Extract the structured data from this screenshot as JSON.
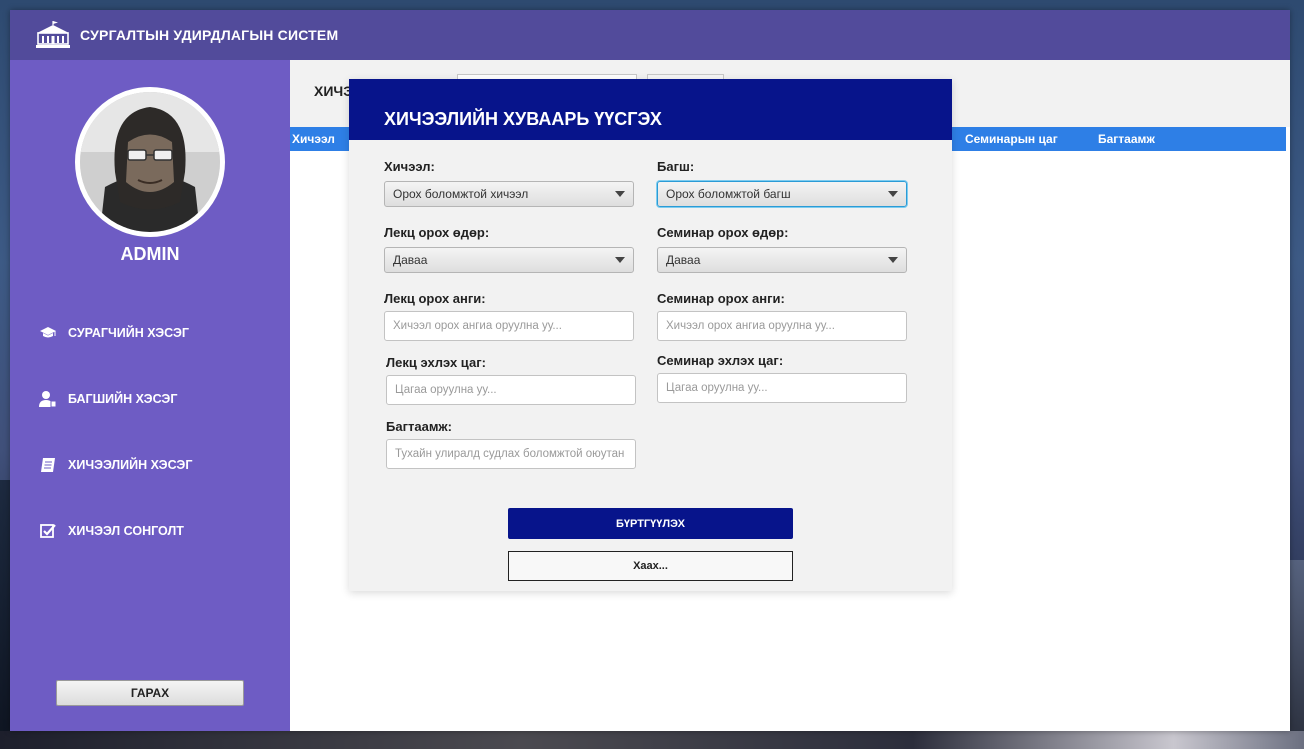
{
  "app": {
    "title": "СУРГАЛТЫН УДИРДЛАГЫН СИСТЕМ"
  },
  "sidebar": {
    "user_name": "ADMIN",
    "items": [
      {
        "label": "СУРАГЧИЙН ХЭСЭГ",
        "icon": "graduation-cap-icon"
      },
      {
        "label": "БАГШИЙН ХЭСЭГ",
        "icon": "teacher-icon"
      },
      {
        "label": "ХИЧЭЭЛИЙН ХЭСЭГ",
        "icon": "book-icon"
      },
      {
        "label": "ХИЧЭЭЛ СОНГОЛТ",
        "icon": "checkbox-icon"
      }
    ],
    "logout_label": "ГАРАХ"
  },
  "main": {
    "heading": "ХИЧЭ",
    "table_headers": {
      "col1": "Хичээл",
      "col_seminar_time": "Семинарын цаг",
      "col_capacity": "Багтаамж"
    }
  },
  "modal": {
    "title": "ХИЧЭЭЛИЙН ХУВААРЬ ҮҮСГЭХ",
    "course_label": "Хичээл:",
    "course_value": "Орох боломжтой хичээл",
    "teacher_label": "Багш:",
    "teacher_value": "Орох боломжтой багш",
    "lecture_day_label": "Лекц орох өдөр:",
    "lecture_day_value": "Даваа",
    "seminar_day_label": "Семинар орох өдөр:",
    "seminar_day_value": "Даваа",
    "lecture_room_label": "Лекц орох анги:",
    "lecture_room_placeholder": "Хичээл орох ангиа оруулна уу...",
    "seminar_room_label": "Семинар орох анги:",
    "seminar_room_placeholder": "Хичээл орох ангиа оруулна уу...",
    "lecture_time_label": "Лекц эхлэх цаг:",
    "lecture_time_placeholder": "Цагаа оруулна уу...",
    "seminar_time_label": "Семинар эхлэх цаг:",
    "seminar_time_placeholder": "Цагаа оруулна уу...",
    "capacity_label": "Багтаамж:",
    "capacity_placeholder": "Тухайн улиралд судлах боломжтой оюутан",
    "submit_label": "БҮРТГҮҮЛЭХ",
    "close_label": "Хаах..."
  },
  "colors": {
    "titlebar": "#524b9b",
    "sidebar": "#6e5cc4",
    "modal_header": "#07148b",
    "table_header": "#2e7fe6",
    "primary_button": "#07148b"
  }
}
